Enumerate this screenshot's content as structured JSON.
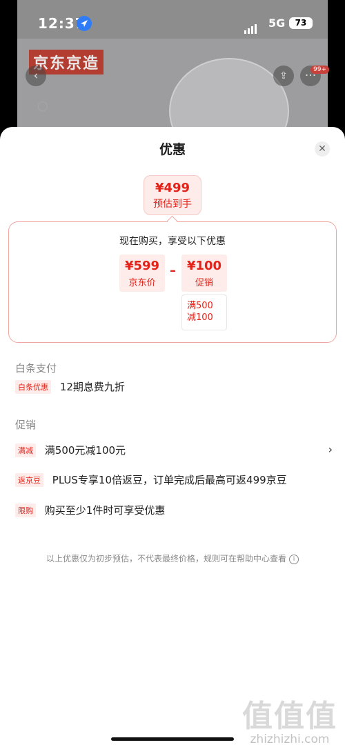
{
  "status_bar": {
    "time": "12:37",
    "network": "5G",
    "battery": "73"
  },
  "background": {
    "brand_logo": "京东京造",
    "notification_badge": "99+"
  },
  "sheet": {
    "title": "优惠",
    "close_icon": "close-icon",
    "estimate": {
      "price": "¥499",
      "label": "预估到手"
    },
    "calc": {
      "title": "现在购买，享受以下优惠",
      "base": {
        "price": "¥599",
        "label": "京东价"
      },
      "operator": "–",
      "discount": {
        "price": "¥100",
        "label": "促销"
      },
      "condition": [
        "满500",
        "减100"
      ]
    },
    "baitiao": {
      "heading": "白条支付",
      "tag": "白条优惠",
      "text": "12期息费九折"
    },
    "promotions": {
      "heading": "促销",
      "items": [
        {
          "tag": "满减",
          "text": "满500元减100元",
          "has_chevron": true
        },
        {
          "tag": "返京豆",
          "text": "PLUS专享10倍返豆，订单完成后最高可返499京豆",
          "has_chevron": false
        },
        {
          "tag": "限购",
          "text": "购买至少1件时可享受优惠",
          "has_chevron": false
        }
      ],
      "chevron": "›"
    },
    "disclaimer": "以上优惠仅为初步预估，不代表最终价格，规则可在帮助中心查看"
  },
  "watermark": {
    "mark": "值值值",
    "text": "zhizhizhi.com"
  },
  "colors": {
    "accent": "#e2231a",
    "tag_bg": "#fdecea",
    "card_border": "#f0a7a1"
  }
}
